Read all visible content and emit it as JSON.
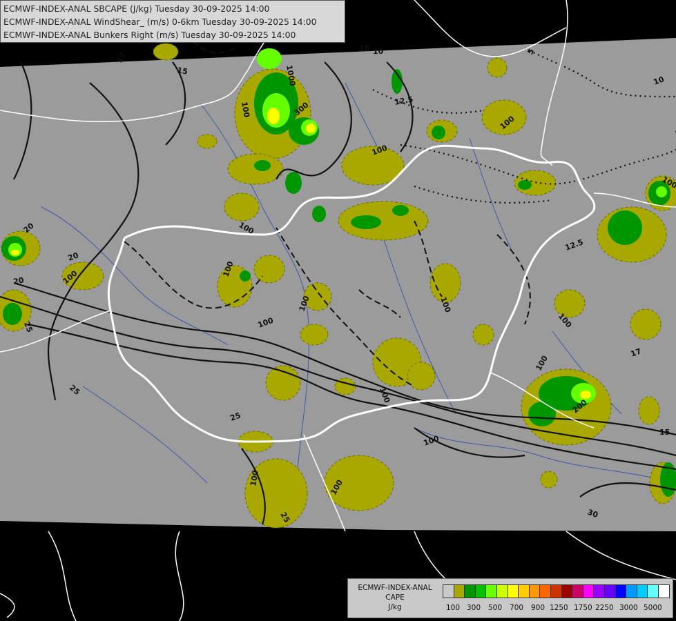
{
  "header": {
    "line1": "ECMWF-INDEX-ANAL SBCAPE (J/kg) Tuesday 30-09-2025 14:00",
    "line2": "ECMWF-INDEX-ANAL WindShear_ (m/s) 0-6km Tuesday 30-09-2025 14:00",
    "line3": "ECMWF-INDEX-ANAL Bunkers Right (m/s) Tuesday 30-09-2025 14:00"
  },
  "legend": {
    "title1": "ECMWF-INDEX-ANAL",
    "title2": "CAPE",
    "unit": "J/kg",
    "colors": [
      "#c8c8c8",
      "#a8a800",
      "#009600",
      "#00c000",
      "#66ff00",
      "#ccff00",
      "#ffff00",
      "#ffcc00",
      "#ff9900",
      "#ff6600",
      "#cc3300",
      "#990000",
      "#cc0066",
      "#ff00ff",
      "#9900ff",
      "#6600ff",
      "#0000ff",
      "#0099ff",
      "#00ccff",
      "#66ffff",
      "#ffffff"
    ],
    "ticks": [
      "100",
      "300",
      "500",
      "700",
      "900",
      "1250",
      "1750",
      "2250",
      "3000",
      "5000"
    ]
  },
  "map": {
    "colors": {
      "background": "#000000",
      "domain": "#9b9b9b",
      "cape_low": "#a8a800",
      "cape_mid": "#009600",
      "cape_high": "#66ff00",
      "cape_peak": "#ffff00",
      "border": "#ffffff",
      "river": "#3a5aa8",
      "contour": "#111111"
    },
    "contour_labels": [
      "17",
      "15",
      "10",
      "5",
      "10",
      "12.5",
      "100",
      "1000",
      "300",
      "100",
      "100",
      "20",
      "20",
      "20",
      "25",
      "100",
      "100",
      "100",
      "100",
      "100",
      "100",
      "12.5",
      "100",
      "17",
      "15",
      "100",
      "200",
      "100",
      "25",
      "25",
      "30",
      "100",
      "100",
      "100",
      "25",
      "100",
      "10"
    ]
  }
}
